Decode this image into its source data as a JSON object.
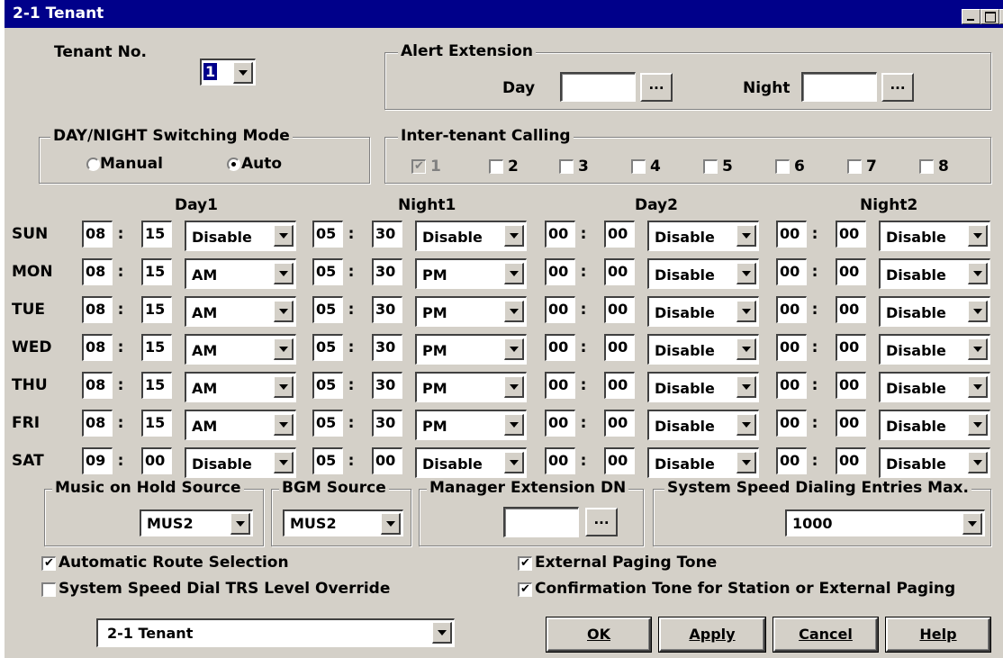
{
  "window": {
    "title": "2-1 Tenant"
  },
  "tenant": {
    "label": "Tenant No.",
    "value": "1"
  },
  "alert": {
    "legend": "Alert Extension",
    "day_label": "Day",
    "day_value": "",
    "night_label": "Night",
    "night_value": "",
    "browse": "..."
  },
  "switching": {
    "legend": "DAY/NIGHT Switching Mode",
    "manual": "Manual",
    "auto": "Auto",
    "selected": "Auto"
  },
  "intertenant": {
    "legend": "Inter-tenant Calling",
    "items": [
      {
        "label": "1",
        "checked": true,
        "disabled": true
      },
      {
        "label": "2",
        "checked": false
      },
      {
        "label": "3",
        "checked": false
      },
      {
        "label": "4",
        "checked": false
      },
      {
        "label": "5",
        "checked": false
      },
      {
        "label": "6",
        "checked": false
      },
      {
        "label": "7",
        "checked": false
      },
      {
        "label": "8",
        "checked": false
      }
    ]
  },
  "schedule": {
    "headers": [
      "Day1",
      "Night1",
      "Day2",
      "Night2"
    ],
    "rows": [
      {
        "day": "SUN",
        "d1": [
          "08",
          "15",
          "Disable"
        ],
        "n1": [
          "05",
          "30",
          "Disable"
        ],
        "d2": [
          "00",
          "00",
          "Disable"
        ],
        "n2": [
          "00",
          "00",
          "Disable"
        ]
      },
      {
        "day": "MON",
        "d1": [
          "08",
          "15",
          "AM"
        ],
        "n1": [
          "05",
          "30",
          "PM"
        ],
        "d2": [
          "00",
          "00",
          "Disable"
        ],
        "n2": [
          "00",
          "00",
          "Disable"
        ]
      },
      {
        "day": "TUE",
        "d1": [
          "08",
          "15",
          "AM"
        ],
        "n1": [
          "05",
          "30",
          "PM"
        ],
        "d2": [
          "00",
          "00",
          "Disable"
        ],
        "n2": [
          "00",
          "00",
          "Disable"
        ]
      },
      {
        "day": "WED",
        "d1": [
          "08",
          "15",
          "AM"
        ],
        "n1": [
          "05",
          "30",
          "PM"
        ],
        "d2": [
          "00",
          "00",
          "Disable"
        ],
        "n2": [
          "00",
          "00",
          "Disable"
        ]
      },
      {
        "day": "THU",
        "d1": [
          "08",
          "15",
          "AM"
        ],
        "n1": [
          "05",
          "30",
          "PM"
        ],
        "d2": [
          "00",
          "00",
          "Disable"
        ],
        "n2": [
          "00",
          "00",
          "Disable"
        ]
      },
      {
        "day": "FRI",
        "d1": [
          "08",
          "15",
          "AM"
        ],
        "n1": [
          "05",
          "30",
          "PM"
        ],
        "d2": [
          "00",
          "00",
          "Disable"
        ],
        "n2": [
          "00",
          "00",
          "Disable"
        ]
      },
      {
        "day": "SAT",
        "d1": [
          "09",
          "00",
          "Disable"
        ],
        "n1": [
          "05",
          "00",
          "Disable"
        ],
        "d2": [
          "00",
          "00",
          "Disable"
        ],
        "n2": [
          "00",
          "00",
          "Disable"
        ]
      }
    ]
  },
  "moh": {
    "legend": "Music on Hold Source",
    "value": "MUS2"
  },
  "bgm": {
    "legend": "BGM Source",
    "value": "MUS2"
  },
  "manager": {
    "legend": "Manager Extension DN",
    "value": "",
    "browse": "..."
  },
  "speed": {
    "legend": "System Speed Dialing Entries Max.",
    "value": "1000"
  },
  "options": {
    "auto_route": {
      "label": "Automatic Route Selection",
      "checked": true
    },
    "trs_override": {
      "label": "System Speed Dial TRS Level Override",
      "checked": false
    },
    "ext_paging": {
      "label": "External Paging Tone",
      "checked": true
    },
    "confirm_tone": {
      "label": "Confirmation Tone for Station or External Paging",
      "checked": true
    }
  },
  "nav": {
    "value": "2-1 Tenant"
  },
  "buttons": {
    "ok": "OK",
    "apply": "Apply",
    "cancel": "Cancel",
    "help": "Help"
  }
}
